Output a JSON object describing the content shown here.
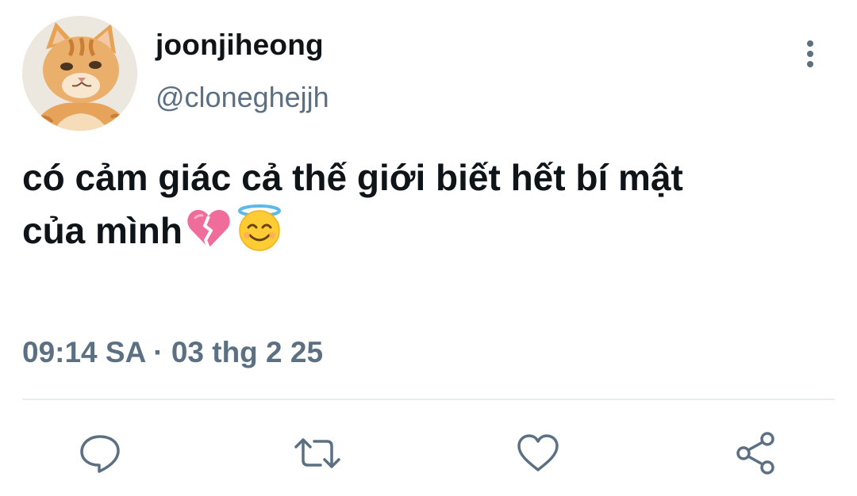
{
  "user": {
    "display_name": "joonjiheong",
    "handle": "@cloneghejjh"
  },
  "tweet": {
    "text": "có cảm giác cả thế giới biết hết bí mật\ncủa mình",
    "emojis": [
      "broken-heart-emoji",
      "smiling-face-with-halo-emoji"
    ],
    "timestamp": "09:14 SA · 03 thg 2 25"
  },
  "actions": [
    {
      "name": "reply",
      "icon": "reply-icon"
    },
    {
      "name": "retweet",
      "icon": "retweet-icon"
    },
    {
      "name": "like",
      "icon": "heart-icon"
    },
    {
      "name": "share",
      "icon": "share-icon"
    }
  ],
  "colors": {
    "text_primary": "#0f1419",
    "text_secondary": "#5b7083",
    "divider": "#e6ecf0",
    "broken_heart": "#f06c9b",
    "emoji_face": "#ffcc33",
    "halo": "#5fb8e8"
  }
}
